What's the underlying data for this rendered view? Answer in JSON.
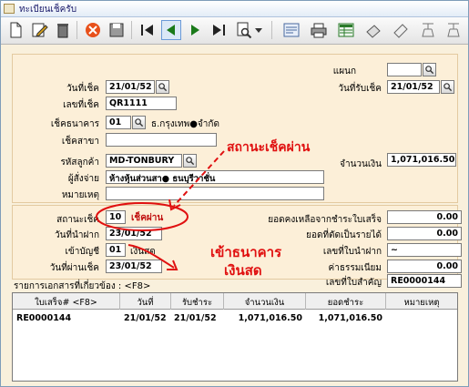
{
  "window": {
    "title": "ทะเบียนเช็ครับ"
  },
  "toolbar": {
    "icons": [
      "new-document-icon",
      "edit-icon",
      "delete-bin-icon",
      "cancel-icon",
      "save-disk-icon",
      "first-record-icon",
      "previous-record-icon",
      "next-record-icon",
      "last-record-icon",
      "search-icon",
      "dropdown-arrow-icon",
      "report-icon",
      "print-icon",
      "excel-export-icon",
      "open-icon",
      "sign-icon",
      "settings-icon",
      "setup-icon"
    ]
  },
  "header": {
    "branch_label": "แผนก",
    "branch_value": "",
    "cheque_date_label": "วันที่เช็ค",
    "cheque_date": "21/01/52",
    "receive_date_label": "วันที่รับเช็ค",
    "receive_date": "21/01/52",
    "cheque_no_label": "เลขที่เช็ค",
    "cheque_no": "QR1111",
    "bank_label": "เช็คธนาคาร",
    "bank_code": "01",
    "bank_name": "ธ.กรุงเทพ●จำกัด",
    "bank_branch_label": "เช็คสาขา",
    "bank_branch_value": "",
    "customer_code_label": "รหัสลูกค้า",
    "customer_code": "MD-TONBURY",
    "amount_label": "จำนวนเงิน",
    "amount": "1,071,016.50",
    "payer_label": "ผู้สั่งจ่าย",
    "payer": "ห้างหุ้นส่วนสา● ธนบุรีวาชั่น",
    "remark_label": "หมายเหตุ",
    "remark": ""
  },
  "status": {
    "status_label": "สถานะเช็ค",
    "status_code": "10",
    "status_text": "เช็คผ่าน",
    "deposit_date_label": "วันที่นำฝาก",
    "deposit_date": "23/01/52",
    "account_label": "เข้าบัญชี",
    "account_code": "01",
    "account_name": "เงินสด",
    "pass_date_label": "วันที่ผ่านเช็ค",
    "pass_date": "23/01/52",
    "balance_label": "ยอดคงเหลือจากชำระใบเสร็จ",
    "balance": "0.00",
    "offset_label": "ยอดที่ตัดเป็นรายได้",
    "offset": "0.00",
    "deposit_slip_label": "เลขที่ใบนำฝาก",
    "deposit_slip": "~",
    "fee_label": "ค่าธรรมเนียม",
    "fee": "0.00",
    "doc_no_label": "เลขที่ใบสำคัญ",
    "doc_no": "RE0000144"
  },
  "related": {
    "label": "รายการเอกสารที่เกี่ยวข้อง : <F8>",
    "columns": [
      "ใบเสร็จ# <F8>",
      "วันที่",
      "รับชำระ",
      "จำนวนเงิน",
      "ยอดชำระ",
      "หมายเหตุ"
    ],
    "rows": [
      [
        "RE0000144",
        "21/01/52",
        "21/01/52",
        "1,071,016.50",
        "1,071,016.50",
        ""
      ]
    ]
  },
  "annotations": {
    "status_passed": "สถานะเช็คผ่าน",
    "deposit_cash_line1": "เข้าธนาคาร",
    "deposit_cash_line2": "เงินสด"
  },
  "colors": {
    "annotation": "#e01010",
    "panel": "#fcefd8"
  }
}
